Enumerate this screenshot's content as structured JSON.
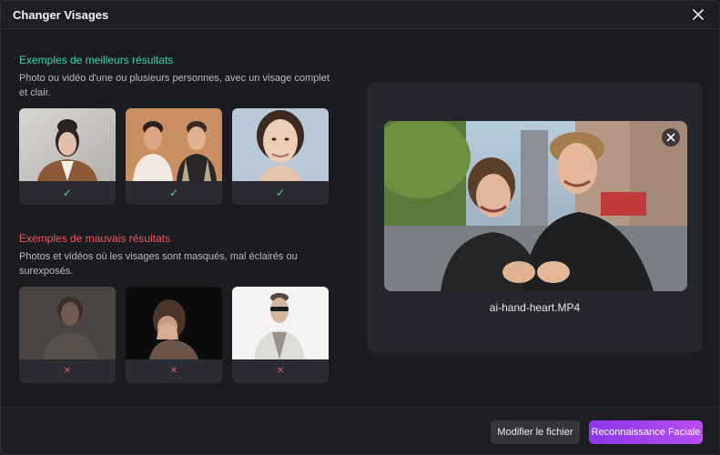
{
  "dialog": {
    "title": "Changer Visages",
    "close_icon": "close-icon"
  },
  "good_examples": {
    "title": "Exemples de meilleurs résultats",
    "description": "Photo ou vidéo d'une ou plusieurs personnes, avec un visage complet et clair.",
    "color": "#3dd6a0",
    "items": [
      {
        "status": "check-icon",
        "mark": "✓"
      },
      {
        "status": "check-icon",
        "mark": "✓"
      },
      {
        "status": "check-icon",
        "mark": "✓"
      }
    ]
  },
  "bad_examples": {
    "title": "Exemples de mauvais résultats",
    "description": "Photos et vidéos où les visages sont masqués, mal éclairés ou surexposés.",
    "color": "#f0565c",
    "items": [
      {
        "status": "cross-icon",
        "mark": "✕"
      },
      {
        "status": "cross-icon",
        "mark": "✕"
      },
      {
        "status": "cross-icon",
        "mark": "✕"
      }
    ]
  },
  "preview": {
    "file_name": "ai-hand-heart.MP4",
    "remove_icon": "close-icon"
  },
  "footer": {
    "modify_label": "Modifier le fichier",
    "recognize_label": "Reconnaissance Faciale",
    "accent_color": "#9b3ff0"
  }
}
